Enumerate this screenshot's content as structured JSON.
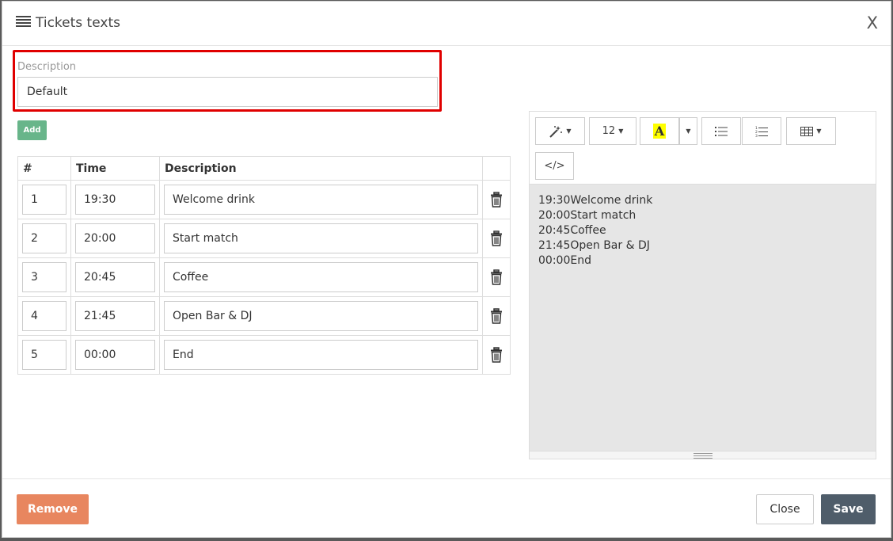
{
  "modal": {
    "title": "Tickets texts",
    "close_label": "X"
  },
  "description": {
    "label": "Description",
    "value": "Default"
  },
  "add_label": "Add",
  "table": {
    "headers": [
      "#",
      "Time",
      "Description"
    ],
    "rows": [
      {
        "num": "1",
        "time": "19:30",
        "desc": "Welcome drink"
      },
      {
        "num": "2",
        "time": "20:00",
        "desc": "Start match"
      },
      {
        "num": "3",
        "time": "20:45",
        "desc": "Coffee"
      },
      {
        "num": "4",
        "time": "21:45",
        "desc": "Open Bar & DJ"
      },
      {
        "num": "5",
        "time": "00:00",
        "desc": "End"
      }
    ]
  },
  "editor": {
    "font_size": "12",
    "font_color_letter": "A",
    "code_label": "</>",
    "lines": [
      "19:30Welcome drink",
      "20:00Start match",
      "20:45Coffee",
      "21:45Open Bar & DJ",
      "00:00End"
    ]
  },
  "footer": {
    "remove_label": "Remove",
    "close_label": "Close",
    "save_label": "Save"
  },
  "colors": {
    "highlight": "#e00000",
    "add_button": "#68b58a",
    "remove_button": "#e8865f",
    "save_button": "#4f5d6a",
    "font_color_highlight": "#ffff00"
  },
  "icons": [
    "list-icon",
    "trash-icon",
    "magic-wand-icon",
    "font-color-icon",
    "bulleted-list-icon",
    "numbered-list-icon",
    "table-icon",
    "code-view-icon",
    "resize-grip-icon"
  ]
}
